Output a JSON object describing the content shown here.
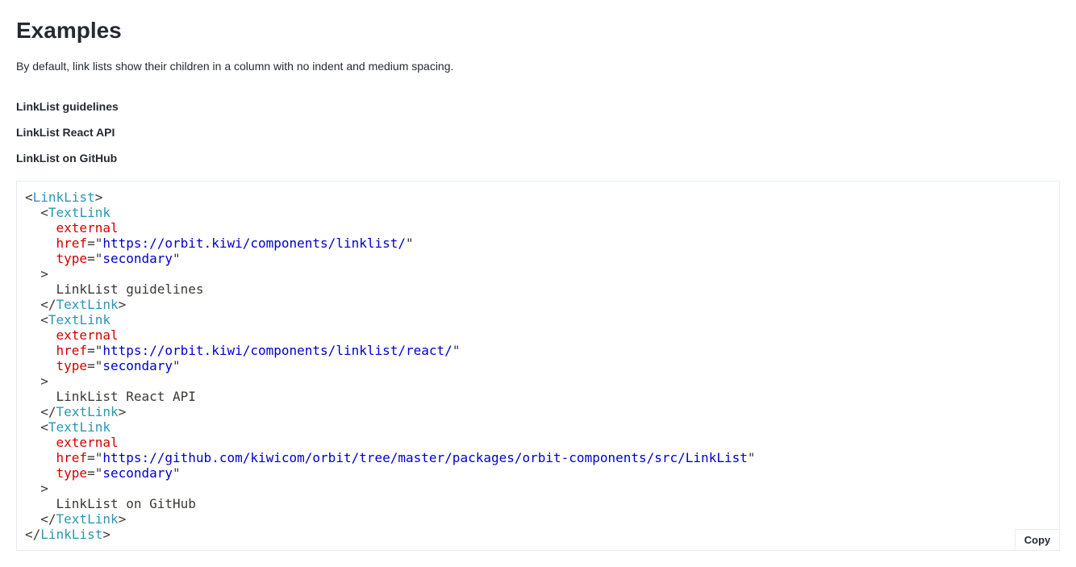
{
  "heading": "Examples",
  "description": "By default, link lists show their children in a column with no indent and medium spacing.",
  "links": [
    {
      "label": "LinkList guidelines"
    },
    {
      "label": "LinkList React API"
    },
    {
      "label": "LinkList on GitHub"
    }
  ],
  "code": {
    "outer_tag": "LinkList",
    "inner_tag": "TextLink",
    "attr_external": "external",
    "attr_href": "href",
    "attr_type": "type",
    "type_value": "secondary",
    "items": [
      {
        "href": "https://orbit.kiwi/components/linklist/",
        "text": "LinkList guidelines"
      },
      {
        "href": "https://orbit.kiwi/components/linklist/react/",
        "text": "LinkList React API"
      },
      {
        "href": "https://github.com/kiwicom/orbit/tree/master/packages/orbit-components/src/LinkList",
        "text": "LinkList on GitHub"
      }
    ]
  },
  "copy_label": "Copy",
  "colors": {
    "tag": "#2c96b3",
    "attr": "#d40000",
    "string": "#0000cc",
    "text": "#252a31",
    "border": "#e8edf1"
  }
}
